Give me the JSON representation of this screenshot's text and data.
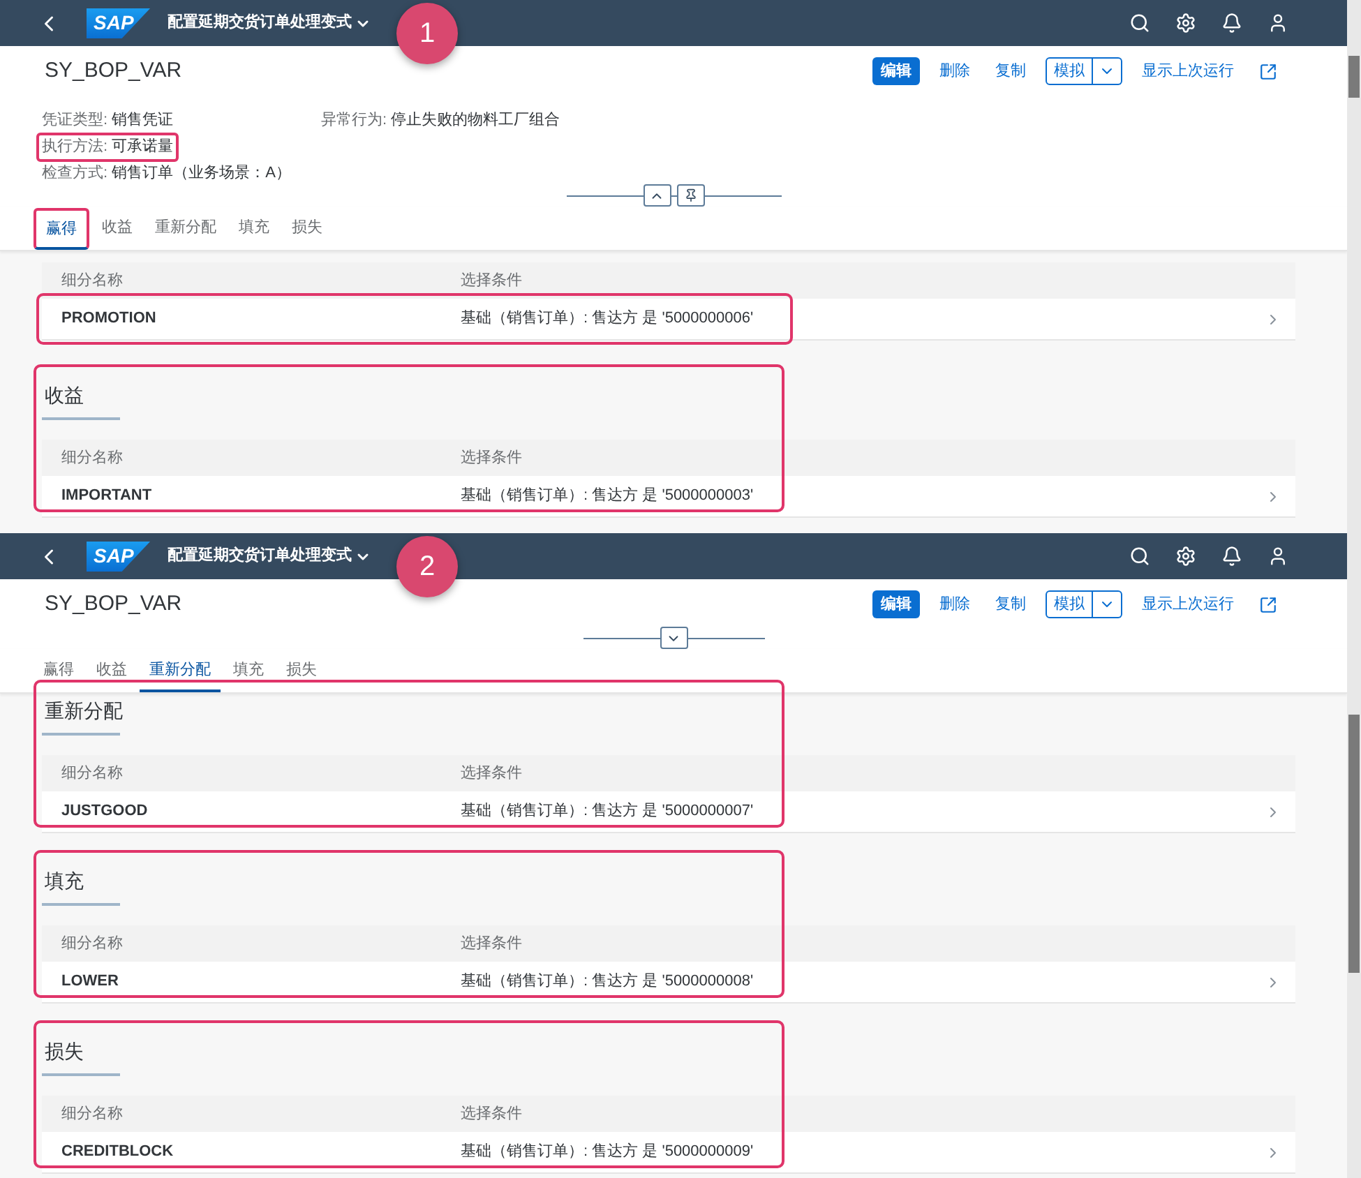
{
  "panels": [
    {
      "badge": "1",
      "shell": {
        "logo": "SAP",
        "title": "配置延期交货订单处理变式"
      },
      "object_title": "SY_BOP_VAR",
      "actions": [
        {
          "kind": "emphasized",
          "label": "编辑"
        },
        {
          "kind": "plain",
          "label": "删除"
        },
        {
          "kind": "plain",
          "label": "复制"
        },
        {
          "kind": "split",
          "label": "模拟"
        },
        {
          "kind": "plain",
          "label": "显示上次运行"
        }
      ],
      "header_expanded": true,
      "field_columns": [
        [
          {
            "label": "凭证类型:",
            "value": "销售凭证",
            "highlighted": false
          },
          {
            "label": "执行方法:",
            "value": "可承诺量",
            "highlighted": true
          },
          {
            "label": "检查方式:",
            "value": "销售订单（业务场景：A）",
            "highlighted": false
          }
        ],
        [
          {
            "label": "异常行为:",
            "value": "停止失败的物料工厂组合",
            "highlighted": false
          }
        ]
      ],
      "tabs": [
        {
          "label": "赢得",
          "selected": true,
          "highlighted": true
        },
        {
          "label": "收益",
          "selected": false,
          "highlighted": false
        },
        {
          "label": "重新分配",
          "selected": false,
          "highlighted": false
        },
        {
          "label": "填充",
          "selected": false,
          "highlighted": false
        },
        {
          "label": "损失",
          "selected": false,
          "highlighted": false
        }
      ],
      "sections": [
        {
          "highlighted": false,
          "columns": [
            "细分名称",
            "选择条件"
          ],
          "rows": [
            {
              "name": "PROMOTION",
              "condition": "基础（销售订单）: 售达方 是 '5000000006'",
              "highlighted": true
            }
          ]
        },
        {
          "title": "收益",
          "highlighted": true,
          "columns": [
            "细分名称",
            "选择条件"
          ],
          "rows": [
            {
              "name": "IMPORTANT",
              "condition": "基础（销售订单）: 售达方 是 '5000000003'",
              "highlighted": false
            }
          ]
        }
      ]
    },
    {
      "badge": "2",
      "shell": {
        "logo": "SAP",
        "title": "配置延期交货订单处理变式"
      },
      "object_title": "SY_BOP_VAR",
      "actions": [
        {
          "kind": "emphasized",
          "label": "编辑"
        },
        {
          "kind": "plain",
          "label": "删除"
        },
        {
          "kind": "plain",
          "label": "复制"
        },
        {
          "kind": "split",
          "label": "模拟"
        },
        {
          "kind": "plain",
          "label": "显示上次运行"
        }
      ],
      "header_expanded": false,
      "tabs": [
        {
          "label": "赢得",
          "selected": false,
          "highlighted": false
        },
        {
          "label": "收益",
          "selected": false,
          "highlighted": false
        },
        {
          "label": "重新分配",
          "selected": true,
          "highlighted": false
        },
        {
          "label": "填充",
          "selected": false,
          "highlighted": false
        },
        {
          "label": "损失",
          "selected": false,
          "highlighted": false
        }
      ],
      "sections": [
        {
          "title": "重新分配",
          "highlighted": true,
          "columns": [
            "细分名称",
            "选择条件"
          ],
          "rows": [
            {
              "name": "JUSTGOOD",
              "condition": "基础（销售订单）: 售达方 是 '5000000007'",
              "highlighted": false
            }
          ]
        },
        {
          "title": "填充",
          "highlighted": true,
          "columns": [
            "细分名称",
            "选择条件"
          ],
          "rows": [
            {
              "name": "LOWER",
              "condition": "基础（销售订单）: 售达方 是 '5000000008'",
              "highlighted": false
            }
          ]
        },
        {
          "title": "损失",
          "highlighted": true,
          "columns": [
            "细分名称",
            "选择条件"
          ],
          "rows": [
            {
              "name": "CREDITBLOCK",
              "condition": "基础（销售订单）: 售达方 是 '5000000009'",
              "highlighted": false
            }
          ]
        }
      ]
    }
  ]
}
